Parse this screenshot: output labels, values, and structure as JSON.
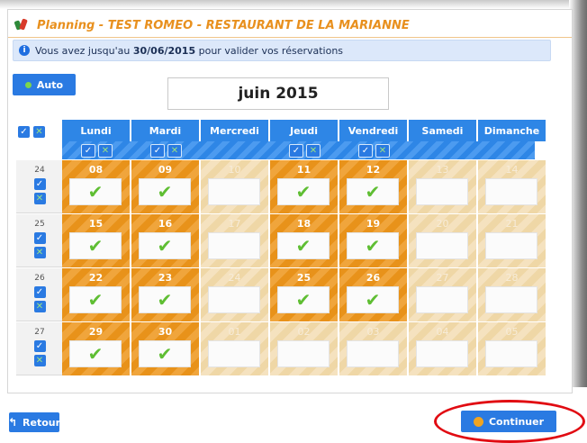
{
  "window": {
    "title": "Planning - TEST ROMEO - RESTAURANT DE LA MARIANNE"
  },
  "info": {
    "text_before": "Vous avez jusqu'au",
    "deadline": "30/06/2015",
    "text_after": "pour valider vos réservations"
  },
  "toolbar": {
    "auto_label": "Auto",
    "month_label": "juin 2015"
  },
  "calendar": {
    "days": [
      "Lundi",
      "Mardi",
      "Mercredi",
      "Jeudi",
      "Vendredi",
      "Samedi",
      "Dimanche"
    ],
    "weeks": [
      {
        "week": "24",
        "cells": [
          {
            "day": "08",
            "active": true,
            "checked": true
          },
          {
            "day": "09",
            "active": true,
            "checked": true
          },
          {
            "day": "10",
            "active": false,
            "checked": false
          },
          {
            "day": "11",
            "active": true,
            "checked": true
          },
          {
            "day": "12",
            "active": true,
            "checked": true
          },
          {
            "day": "13",
            "active": false,
            "checked": false
          },
          {
            "day": "14",
            "active": false,
            "checked": false
          }
        ]
      },
      {
        "week": "25",
        "cells": [
          {
            "day": "15",
            "active": true,
            "checked": true
          },
          {
            "day": "16",
            "active": true,
            "checked": true
          },
          {
            "day": "17",
            "active": false,
            "checked": false
          },
          {
            "day": "18",
            "active": true,
            "checked": true
          },
          {
            "day": "19",
            "active": true,
            "checked": true
          },
          {
            "day": "20",
            "active": false,
            "checked": false
          },
          {
            "day": "21",
            "active": false,
            "checked": false
          }
        ]
      },
      {
        "week": "26",
        "cells": [
          {
            "day": "22",
            "active": true,
            "checked": true
          },
          {
            "day": "23",
            "active": true,
            "checked": true
          },
          {
            "day": "24",
            "active": false,
            "checked": false
          },
          {
            "day": "25",
            "active": true,
            "checked": true
          },
          {
            "day": "26",
            "active": true,
            "checked": true
          },
          {
            "day": "27",
            "active": false,
            "checked": false
          },
          {
            "day": "28",
            "active": false,
            "checked": false
          }
        ]
      },
      {
        "week": "27",
        "cells": [
          {
            "day": "29",
            "active": true,
            "checked": true
          },
          {
            "day": "30",
            "active": true,
            "checked": true
          },
          {
            "day": "01",
            "active": false,
            "checked": false
          },
          {
            "day": "02",
            "active": false,
            "checked": false
          },
          {
            "day": "03",
            "active": false,
            "checked": false
          },
          {
            "day": "04",
            "active": false,
            "checked": false
          },
          {
            "day": "05",
            "active": false,
            "checked": false
          }
        ]
      }
    ]
  },
  "footer": {
    "back_label": "Retour",
    "continue_label": "Continuer"
  }
}
